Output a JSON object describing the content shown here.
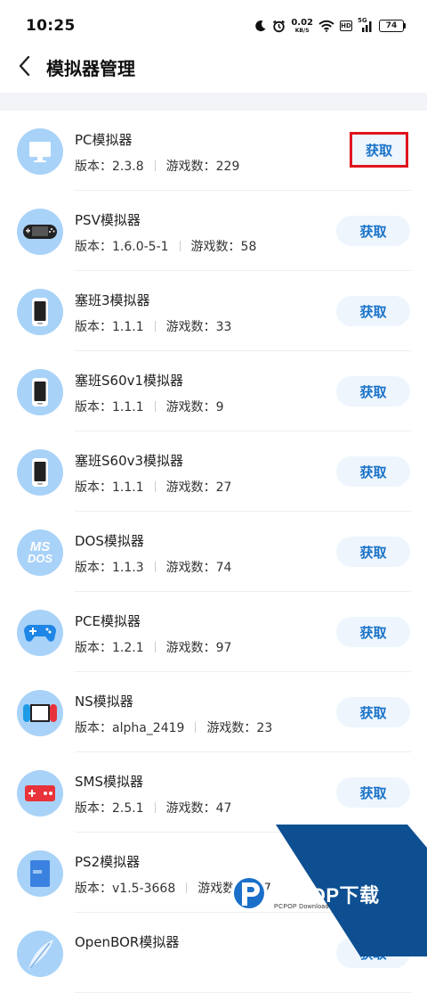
{
  "status_bar": {
    "time": "10:25",
    "net_speed_value": "0.02",
    "net_speed_unit": "KB/S",
    "hd_label": "HD",
    "signal_label": "5G",
    "battery": "74",
    "icons": [
      "moon-icon",
      "alarm-icon",
      "wifi-icon",
      "signal-icon",
      "battery-icon"
    ]
  },
  "header": {
    "title": "模拟器管理",
    "back_icon": "chevron-left-icon"
  },
  "labels": {
    "version_prefix": "版本：",
    "games_prefix": "游戏数："
  },
  "emulators": [
    {
      "name": "PC模拟器",
      "version": "版本：2.3.8",
      "games": "游戏数：229",
      "button": "获取",
      "icon": "monitor-icon",
      "highlighted": true
    },
    {
      "name": "PSV模拟器",
      "version": "版本：1.6.0-5-1",
      "games": "游戏数：58",
      "button": "获取",
      "icon": "handheld-console-icon",
      "highlighted": false
    },
    {
      "name": "塞班3模拟器",
      "version": "版本：1.1.1",
      "games": "游戏数：33",
      "button": "获取",
      "icon": "phone-icon",
      "highlighted": false
    },
    {
      "name": "塞班S60v1模拟器",
      "version": "版本：1.1.1",
      "games": "游戏数：9",
      "button": "获取",
      "icon": "phone-icon",
      "highlighted": false
    },
    {
      "name": "塞班S60v3模拟器",
      "version": "版本：1.1.1",
      "games": "游戏数：27",
      "button": "获取",
      "icon": "phone-icon",
      "highlighted": false
    },
    {
      "name": "DOS模拟器",
      "version": "版本：1.1.3",
      "games": "游戏数：74",
      "button": "获取",
      "icon": "ms-dos-icon",
      "highlighted": false
    },
    {
      "name": "PCE模拟器",
      "version": "版本：1.2.1",
      "games": "游戏数：97",
      "button": "获取",
      "icon": "gamepad-icon",
      "highlighted": false
    },
    {
      "name": "NS模拟器",
      "version": "版本：alpha_2419",
      "games": "游戏数：23",
      "button": "获取",
      "icon": "switch-console-icon",
      "highlighted": false
    },
    {
      "name": "SMS模拟器",
      "version": "版本：2.5.1",
      "games": "游戏数：47",
      "button": "获取",
      "icon": "retro-controller-icon",
      "highlighted": false
    },
    {
      "name": "PS2模拟器",
      "version": "版本：v1.5-3668",
      "games": "游戏数：287",
      "button": "获取",
      "icon": "ps2-disc-case-icon",
      "highlighted": false
    },
    {
      "name": "OpenBOR模拟器",
      "version": "",
      "games": "",
      "button": "获取",
      "icon": "feather-icon",
      "highlighted": false
    }
  ],
  "ms_dos_text": {
    "top": "MS",
    "bottom": "DOS"
  },
  "watermark": {
    "brand": "PCPOP下载",
    "sub": "PCPOP Download"
  },
  "colors": {
    "accent": "#1a73c8",
    "button_bg": "#eef5fd",
    "icon_bg": "#a9d2f8",
    "highlight_border": "#e0141e",
    "watermark_blue": "#0d4f91"
  }
}
